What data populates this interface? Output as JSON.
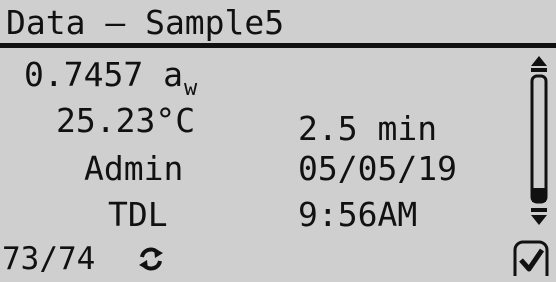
{
  "header": {
    "title": "Data – Sample5"
  },
  "reading": {
    "water_activity_value": "0.7457 a",
    "water_activity_sub": "w",
    "temperature": "25.23°C",
    "duration": "2.5 min",
    "user": "Admin",
    "date": "05/05/19",
    "model": "TDL",
    "time": "9:56AM"
  },
  "footer": {
    "record_counter": "73/74"
  },
  "icons": {
    "cycle": "cycle-arrows-icon",
    "scroll_up": "scroll-up-arrow-icon",
    "scroll_down": "scroll-down-arrow-icon",
    "confirm": "checkmark-icon"
  },
  "colors": {
    "screen_background": "#cfcfcf",
    "foreground": "#111111"
  }
}
